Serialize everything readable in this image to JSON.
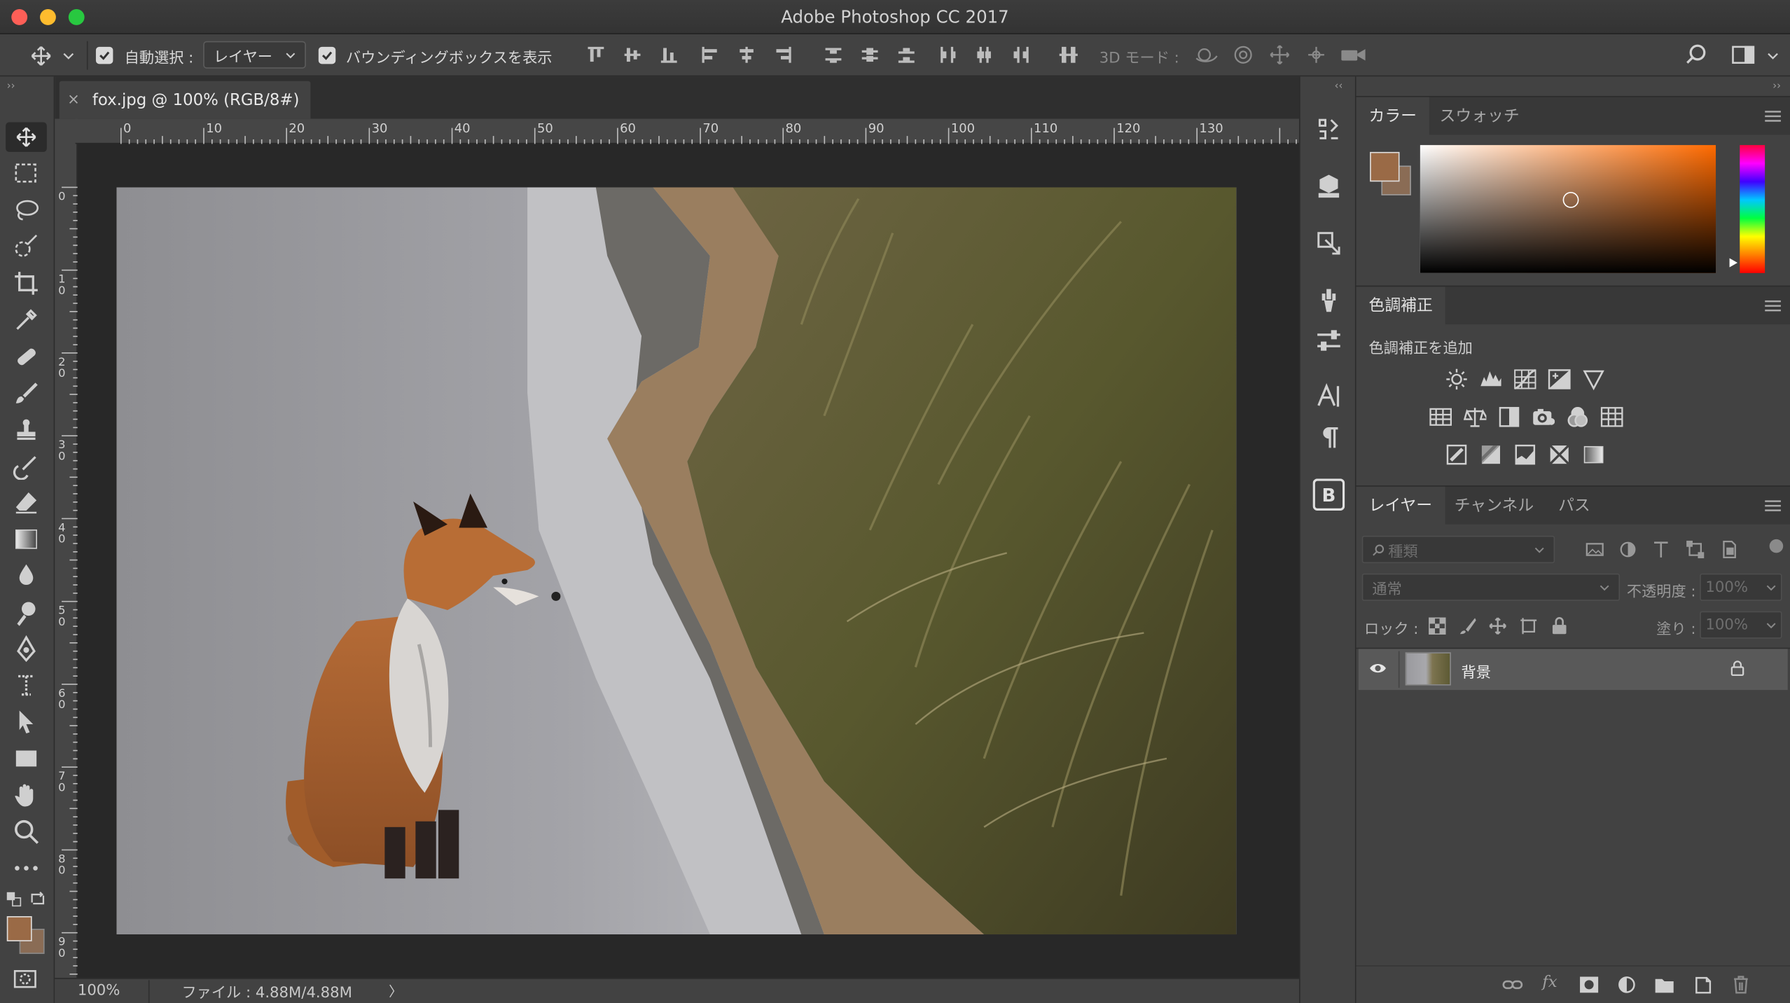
{
  "window": {
    "title": "Adobe Photoshop CC 2017"
  },
  "options": {
    "auto_select_label": "自動選択 :",
    "auto_select_value": "レイヤー",
    "bounding_box_label": "バウンディングボックスを表示",
    "mode3d_label": "3D モード :"
  },
  "document": {
    "tab_title": "fox.jpg @ 100% (RGB/8#)",
    "close_glyph": "×"
  },
  "ruler": {
    "h": [
      "0",
      "10",
      "20",
      "30",
      "40",
      "50",
      "60",
      "70",
      "80",
      "90",
      "100",
      "110",
      "120",
      "130"
    ],
    "v": [
      "0",
      "1\n0",
      "2\n0",
      "3\n0",
      "4\n0",
      "5\n0",
      "6\n0",
      "7\n0",
      "8\n0",
      "9\n0"
    ]
  },
  "status": {
    "zoom": "100%",
    "file_info": "ファイル : 4.88M/4.88M",
    "arrow": "〉"
  },
  "panels": {
    "color": {
      "tabs": [
        "カラー",
        "スウォッチ"
      ],
      "fg": "#9a6a46",
      "bg": "#8a6c55",
      "hue_color": "#ff6a00"
    },
    "adjustments": {
      "tab": "色調補正",
      "subtitle": "色調補正を追加"
    },
    "layers": {
      "tabs": [
        "レイヤー",
        "チャンネル",
        "パス"
      ],
      "search_placeholder": "種類",
      "blend_mode": "通常",
      "opacity_label": "不透明度 :",
      "opacity_value": "100%",
      "lock_label": "ロック :",
      "fill_label": "塗り :",
      "fill_value": "100%",
      "layer_name": "背景"
    }
  },
  "swatch": {
    "fg": "#9a6a46",
    "bg": "#8a6c55"
  }
}
